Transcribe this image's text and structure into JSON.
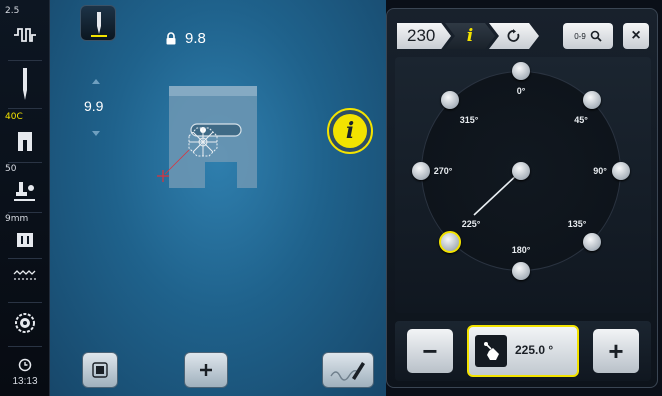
{
  "sidebar": {
    "stitch_width": "2.5",
    "presser_foot": "40C",
    "foot_pressure": "50",
    "stitch_plate": "9mm",
    "time": "13:13"
  },
  "main": {
    "lock_value": "9.8",
    "needle_position": "9.9",
    "info_label": "i"
  },
  "panel": {
    "tab_stitch_number": "230",
    "tab_info_label": "i",
    "tab_reset_icon": "undo-icon",
    "zoom_label": "0-9",
    "close_label": "×",
    "dial_angles": [
      "0°",
      "45°",
      "90°",
      "135°",
      "180°",
      "225°",
      "270°",
      "315°"
    ],
    "selected_angle_label": "225°",
    "angle_value": "225.0 °",
    "minus_label": "−",
    "plus_label": "+"
  },
  "colors": {
    "accent": "#f3e300",
    "screen_blue": "#2f7fae",
    "panel_dark": "#101720"
  }
}
